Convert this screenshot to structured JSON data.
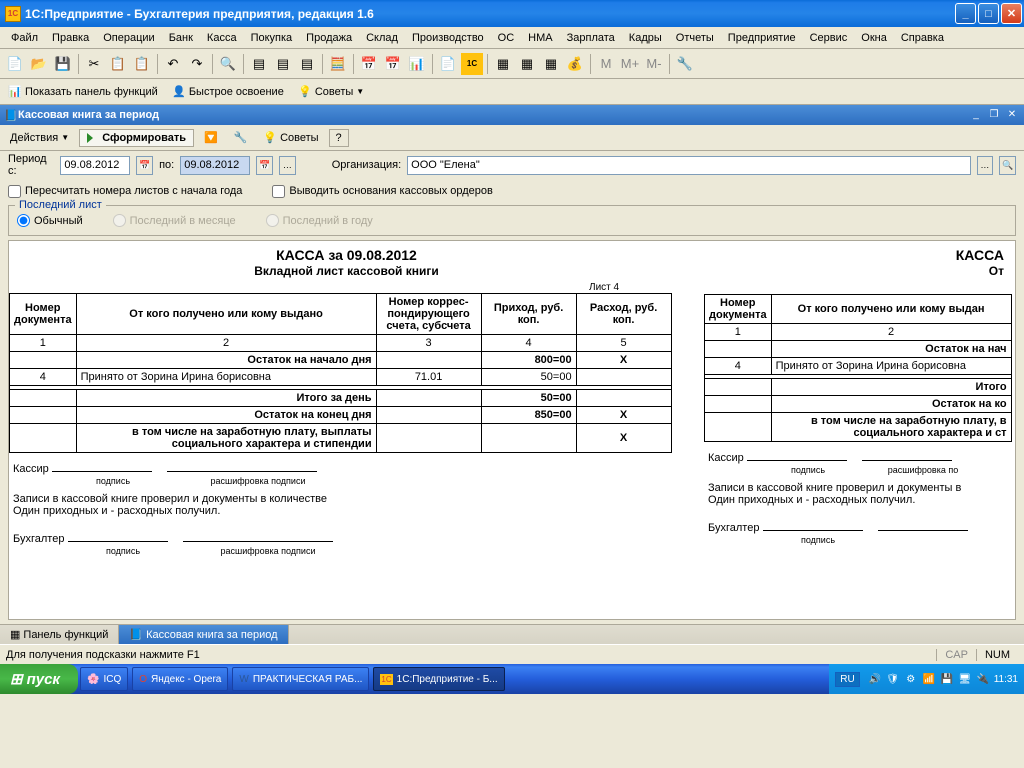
{
  "window": {
    "title": "1С:Предприятие - Бухгалтерия предприятия, редакция 1.6",
    "icon_text": "1C"
  },
  "menu": [
    "Файл",
    "Правка",
    "Операции",
    "Банк",
    "Касса",
    "Покупка",
    "Продажа",
    "Склад",
    "Производство",
    "ОС",
    "НМА",
    "Зарплата",
    "Кадры",
    "Отчеты",
    "Предприятие",
    "Сервис",
    "Окна",
    "Справка"
  ],
  "toolbar_icons": [
    "📄",
    "📂",
    "💾",
    "|",
    "✂",
    "📋",
    "📋",
    "|",
    "↶",
    "↷",
    "|",
    "🔍",
    "|",
    "📋",
    "📋",
    "📋",
    "|",
    "🧮",
    "|",
    "📅",
    "📅",
    "📊",
    "|",
    "📄",
    "🟡",
    "|",
    "📊",
    "📊",
    "📊",
    "💰",
    "|",
    "M",
    "M+",
    "M-",
    "|",
    "🔧"
  ],
  "toolbar2": {
    "panel_functions": "Показать панель функций",
    "quick_start": "Быстрое освоение",
    "advice": "Советы"
  },
  "subwindow": {
    "title": "Кассовая книга за период"
  },
  "actionbar": {
    "actions": "Действия",
    "form": "Сформировать",
    "advice": "Советы",
    "help": "?"
  },
  "params": {
    "period_from_label": "Период с:",
    "date_from": "09.08.2012",
    "to_label": "по:",
    "date_to": "09.08.2012",
    "org_label": "Организация:",
    "org_value": "ООО \"Елена\""
  },
  "checks": {
    "recalc": "Пересчитать номера листов с начала года",
    "output_basis": "Выводить основания кассовых ордеров"
  },
  "group": {
    "legend": "Последний лист",
    "r1": "Обычный",
    "r2": "Последний в месяце",
    "r3": "Последний в году"
  },
  "report": {
    "title": "КАССА за 09.08.2012",
    "sub": "Вкладной лист кассовой книги",
    "sheet": "Лист 4",
    "title2": "КАССА",
    "sub2": "От",
    "headers": {
      "doc_num": "Номер документа",
      "from_to": "От кого получено или кому выдано",
      "corr": "Номер коррес-пондирующего счета, субсчета",
      "income": "Приход, руб. коп.",
      "expense": "Расход, руб. коп.",
      "from_to2": "От кого получено или кому выдан"
    },
    "cols": [
      "1",
      "2",
      "3",
      "4",
      "5",
      "1",
      "2"
    ],
    "rows": {
      "start_balance": "Остаток на начало дня",
      "start_balance_val": "800=00",
      "x": "Х",
      "start_balance2": "Остаток на нач",
      "r_num": "4",
      "r_text": "Принято от Зорина Ирина борисовна",
      "r_corr": "71.01",
      "r_in": "50=00",
      "day_total": "Итого за день",
      "day_total_val": "50=00",
      "day_total2": "Итого",
      "end_balance": "Остаток на конец  дня",
      "end_balance_val": "850=00",
      "end_balance2": "Остаток на ко",
      "salary": "в том числе на заработную плату, выплаты социального характера и стипендии",
      "salary2": "в том числе на заработную плату, в",
      "salary3": "социального характера и ст"
    },
    "sig": {
      "cashier": "Кассир",
      "sign": "подпись",
      "decode": "расшифровка подписи",
      "decode2": "расшифровка по",
      "rec_text": "Записи в кассовой книге проверил и документы в количестве",
      "rec_text2": "Записи в кассовой книге проверил и документы в",
      "rec_text3": "Один приходных и  - расходных получил.",
      "accountant": "Бухгалтер"
    }
  },
  "wintabs": {
    "t1": "Панель функций",
    "t2": "Кассовая книга за период"
  },
  "statusbar": {
    "hint": "Для получения подсказки нажмите F1",
    "cap": "CAP",
    "num": "NUM"
  },
  "taskbar": {
    "start": "пуск",
    "items": [
      "ICQ",
      "Яндекс - Opera",
      "ПРАКТИЧЕСКАЯ РАБ...",
      "1С:Предприятие - Б..."
    ],
    "lang": "RU",
    "time": "11:31"
  }
}
